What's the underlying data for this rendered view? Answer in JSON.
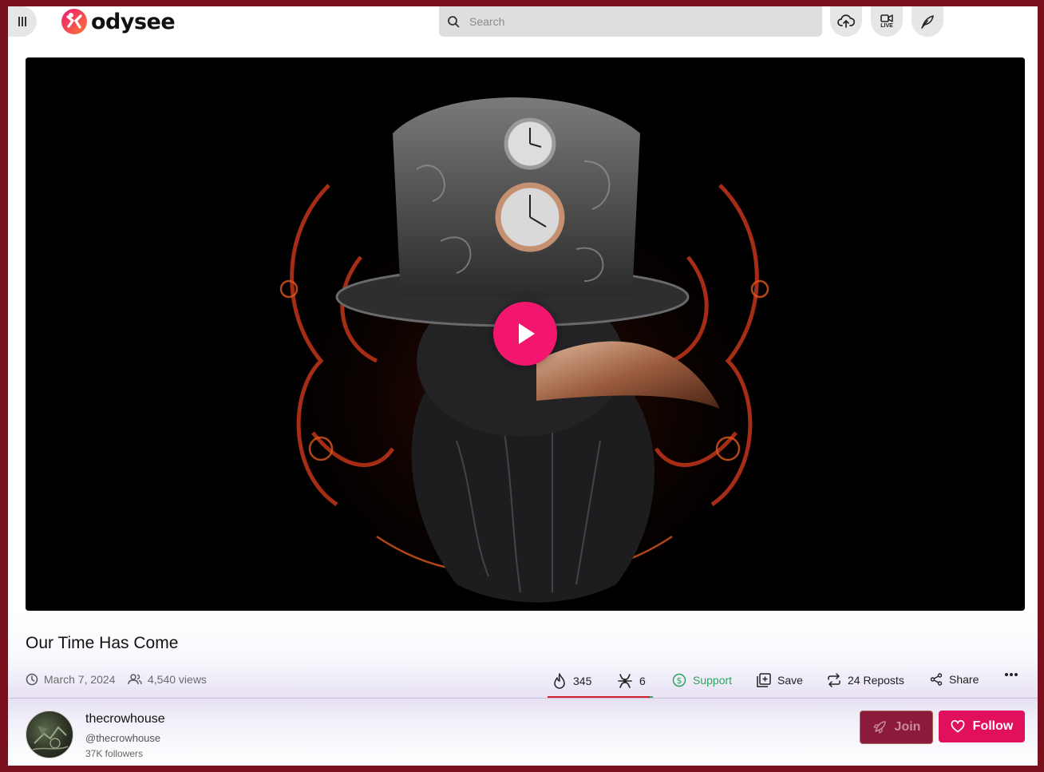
{
  "header": {
    "logo_text": "odysee",
    "search_placeholder": "Search",
    "live_label": "LIVE",
    "icons": [
      "menu-icon",
      "search-icon",
      "upload-icon",
      "go-live-icon",
      "post-icon"
    ]
  },
  "video": {
    "title": "Our Time Has Come",
    "date": "March 7, 2024",
    "views": "4,540 views",
    "play_icon": "play-icon"
  },
  "actions": {
    "fire_count": "345",
    "slime_count": "6",
    "support_label": "Support",
    "save_label": "Save",
    "reposts_label": "24 Reposts",
    "share_label": "Share",
    "more_icon": "more-icon"
  },
  "channel": {
    "name": "thecrowhouse",
    "handle": "@thecrowhouse",
    "followers": "37K followers",
    "join_label": "Join",
    "follow_label": "Follow"
  },
  "colors": {
    "accent": "#e0105c",
    "play": "#f2166e",
    "support": "#2ea360",
    "frame": "#7a0f1d",
    "reaction_bar": "#d32030"
  }
}
